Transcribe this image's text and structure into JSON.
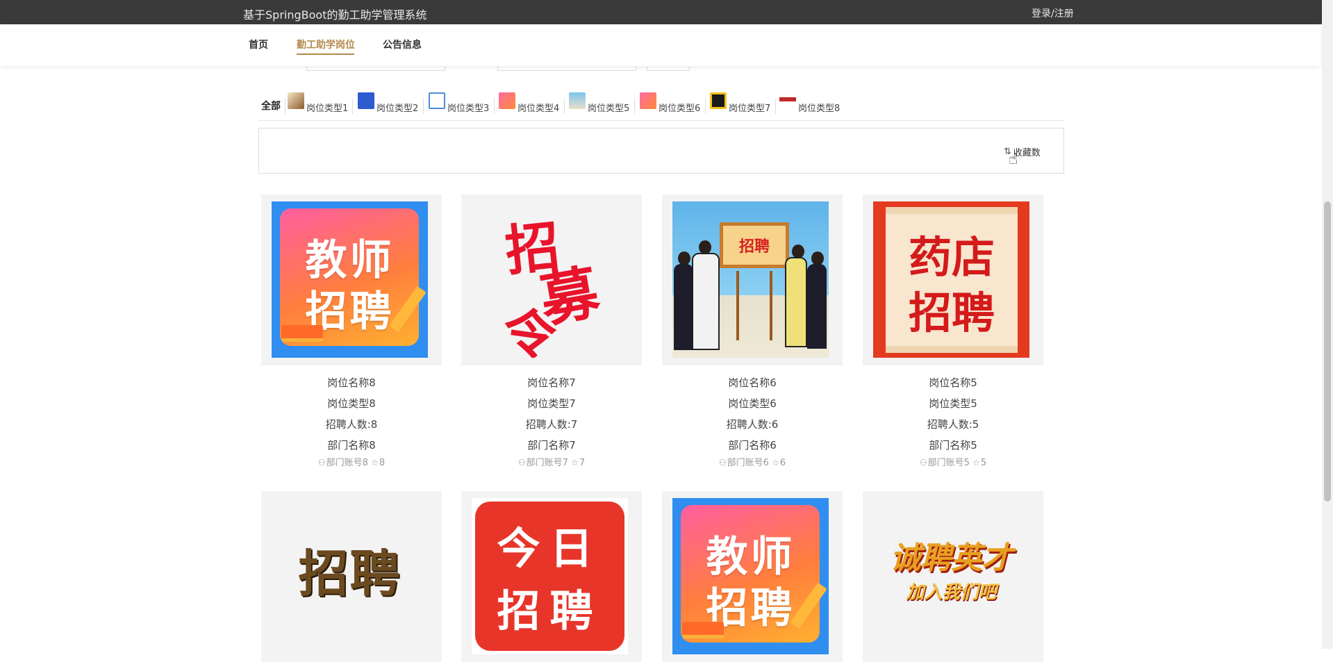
{
  "header": {
    "system_title": "基于SpringBoot的勤工助学管理系统",
    "login_link": "登录/注册"
  },
  "nav": {
    "items": [
      {
        "label": "首页",
        "active": false
      },
      {
        "label": "勤工助学岗位",
        "active": true
      },
      {
        "label": "公告信息",
        "active": false
      }
    ],
    "accent_color": "#b48a4e"
  },
  "filter": {
    "all_label": "全部",
    "categories": [
      {
        "label": "岗位类型1",
        "icon": "category-thumb-1"
      },
      {
        "label": "岗位类型2",
        "icon": "category-thumb-2"
      },
      {
        "label": "岗位类型3",
        "icon": "category-thumb-3"
      },
      {
        "label": "岗位类型4",
        "icon": "category-thumb-4"
      },
      {
        "label": "岗位类型5",
        "icon": "category-thumb-5"
      },
      {
        "label": "岗位类型6",
        "icon": "category-thumb-6"
      },
      {
        "label": "岗位类型7",
        "icon": "category-thumb-7"
      },
      {
        "label": "岗位类型8",
        "icon": "category-thumb-8"
      }
    ]
  },
  "sort": {
    "label": "收藏数",
    "icon": "sort-icon"
  },
  "jobs": [
    {
      "name": "岗位名称8",
      "type": "岗位类型8",
      "count": "招聘人数:8",
      "dept": "部门名称8",
      "account": "部门账号8",
      "favorites": "8",
      "image": "teacher-recruit-poster",
      "image_text": [
        "教师",
        "招聘"
      ]
    },
    {
      "name": "岗位名称7",
      "type": "岗位类型7",
      "count": "招聘人数:7",
      "dept": "部门名称7",
      "account": "部门账号7",
      "favorites": "7",
      "image": "zhaomuling-calligraphy",
      "image_text": [
        "招",
        "募",
        "令"
      ]
    },
    {
      "name": "岗位名称6",
      "type": "岗位类型6",
      "count": "招聘人数:6",
      "dept": "部门名称6",
      "account": "部门账号6",
      "favorites": "6",
      "image": "recruit-easel-scene",
      "image_text": [
        "招聘"
      ]
    },
    {
      "name": "岗位名称5",
      "type": "岗位类型5",
      "count": "招聘人数:5",
      "dept": "部门名称5",
      "account": "部门账号5",
      "favorites": "5",
      "image": "pharmacy-recruit-poster",
      "image_text": [
        "药店",
        "招聘"
      ]
    },
    {
      "image": "gold-recruit-text",
      "image_text": [
        "招聘"
      ]
    },
    {
      "image": "today-recruit-badge",
      "image_text": [
        "今日",
        "招聘"
      ]
    },
    {
      "image": "teacher-recruit-poster",
      "image_text": [
        "教师",
        "招聘"
      ]
    },
    {
      "image": "elite-recruit-banner",
      "image_text": [
        "诚聘英才",
        "加入我们吧"
      ]
    }
  ],
  "icons": {
    "user": "user-icon",
    "star": "star-icon"
  }
}
